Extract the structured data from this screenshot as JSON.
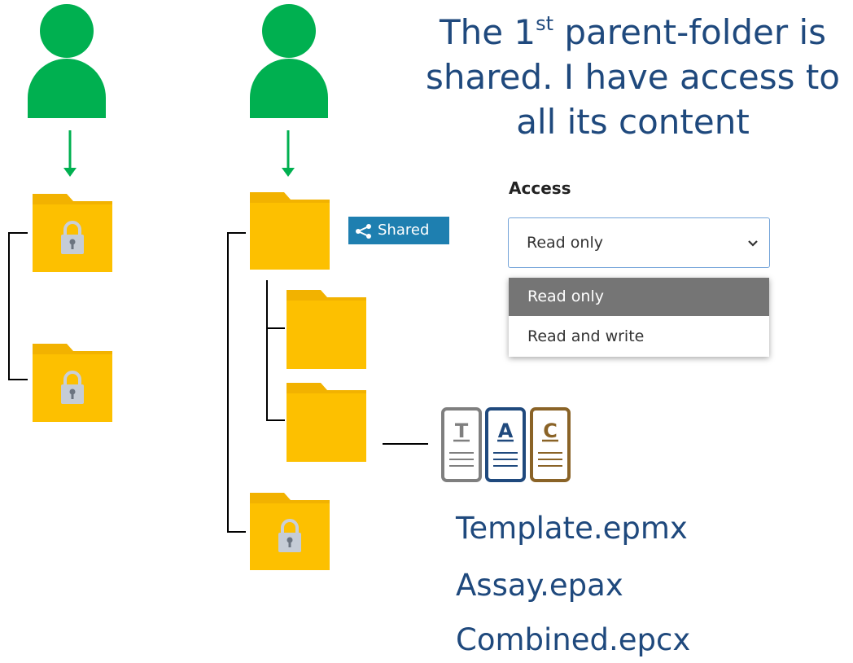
{
  "caption": {
    "line1_before": "The 1",
    "line1_sup": "st",
    "line1_after": " parent-folder is",
    "line2": "shared. I have access to",
    "line3": "all its content"
  },
  "access": {
    "label": "Access",
    "selected": "Read only",
    "options": [
      "Read only",
      "Read and write"
    ]
  },
  "shared_badge": {
    "label": "Shared",
    "icon": "share-icon"
  },
  "file_icons": [
    {
      "letter": "T",
      "color": "#7f7f7f",
      "icon": "template-file-icon"
    },
    {
      "letter": "A",
      "color": "#1f497d",
      "icon": "assay-file-icon"
    },
    {
      "letter": "C",
      "color": "#8a6327",
      "icon": "combined-file-icon"
    }
  ],
  "files": [
    "Template.epmx",
    "Assay.epax",
    "Combined.epcx"
  ],
  "colors": {
    "user": "#00b050",
    "folder": "#fdc000",
    "folder_tab": "#f2b200",
    "text": "#1f497d",
    "badge": "#1e7fb0"
  }
}
